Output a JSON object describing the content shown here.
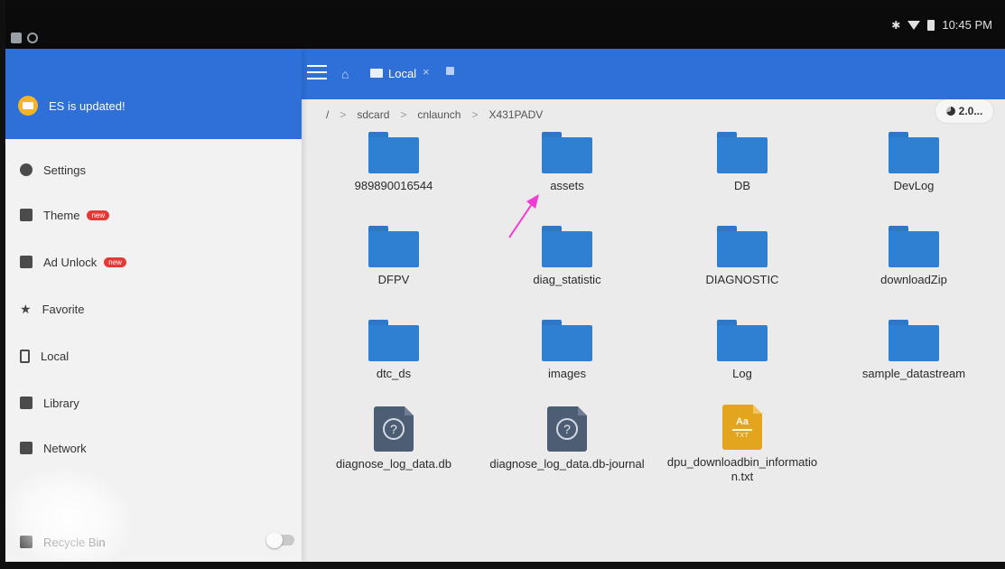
{
  "status_bar": {
    "time": "10:45 PM"
  },
  "app_bar": {
    "tab_label": "Local",
    "tab_close": "×"
  },
  "drawer": {
    "update_message": "ES is updated!",
    "new_badge": "new",
    "items": [
      {
        "label": "Settings",
        "icon": "gear-icon"
      },
      {
        "label": "Theme",
        "icon": "shirt-icon",
        "badge": true
      },
      {
        "label": "Ad Unlock",
        "icon": "unlock-icon",
        "badge": true
      },
      {
        "label": "Favorite",
        "icon": "star-icon"
      },
      {
        "label": "Local",
        "icon": "phone-icon"
      },
      {
        "label": "Library",
        "icon": "library-icon"
      },
      {
        "label": "Network",
        "icon": "network-icon"
      },
      {
        "label": "Recycle Bin",
        "icon": "trash-icon",
        "toggle": "off"
      }
    ]
  },
  "breadcrumb": {
    "root": "/",
    "segments": [
      "sdcard",
      "cnlaunch",
      "X431PADV"
    ]
  },
  "storage_chip": {
    "label": "2.0..."
  },
  "files": [
    {
      "name": "989890016544",
      "type": "folder"
    },
    {
      "name": "assets",
      "type": "folder"
    },
    {
      "name": "DB",
      "type": "folder"
    },
    {
      "name": "DevLog",
      "type": "folder"
    },
    {
      "name": "DFPV",
      "type": "folder"
    },
    {
      "name": "diag_statistic",
      "type": "folder"
    },
    {
      "name": "DIAGNOSTIC",
      "type": "folder"
    },
    {
      "name": "downloadZip",
      "type": "folder"
    },
    {
      "name": "dtc_ds",
      "type": "folder"
    },
    {
      "name": "images",
      "type": "folder"
    },
    {
      "name": "Log",
      "type": "folder"
    },
    {
      "name": "sample_datastream",
      "type": "folder"
    },
    {
      "name": "diagnose_log_data.db",
      "type": "unknown",
      "glyph": "?"
    },
    {
      "name": "diagnose_log_data.db-journal",
      "type": "unknown",
      "glyph": "?"
    },
    {
      "name": "dpu_downloadbin_information.txt",
      "type": "text",
      "icon_text": "Aa",
      "icon_ext": "TXT"
    }
  ],
  "colors": {
    "app_bar": "#2f6fd8",
    "folder": "#2f7fd3",
    "unknown_file": "#4d5d74",
    "text_file": "#e2a51d",
    "annotation_arrow": "#f03bd6"
  }
}
